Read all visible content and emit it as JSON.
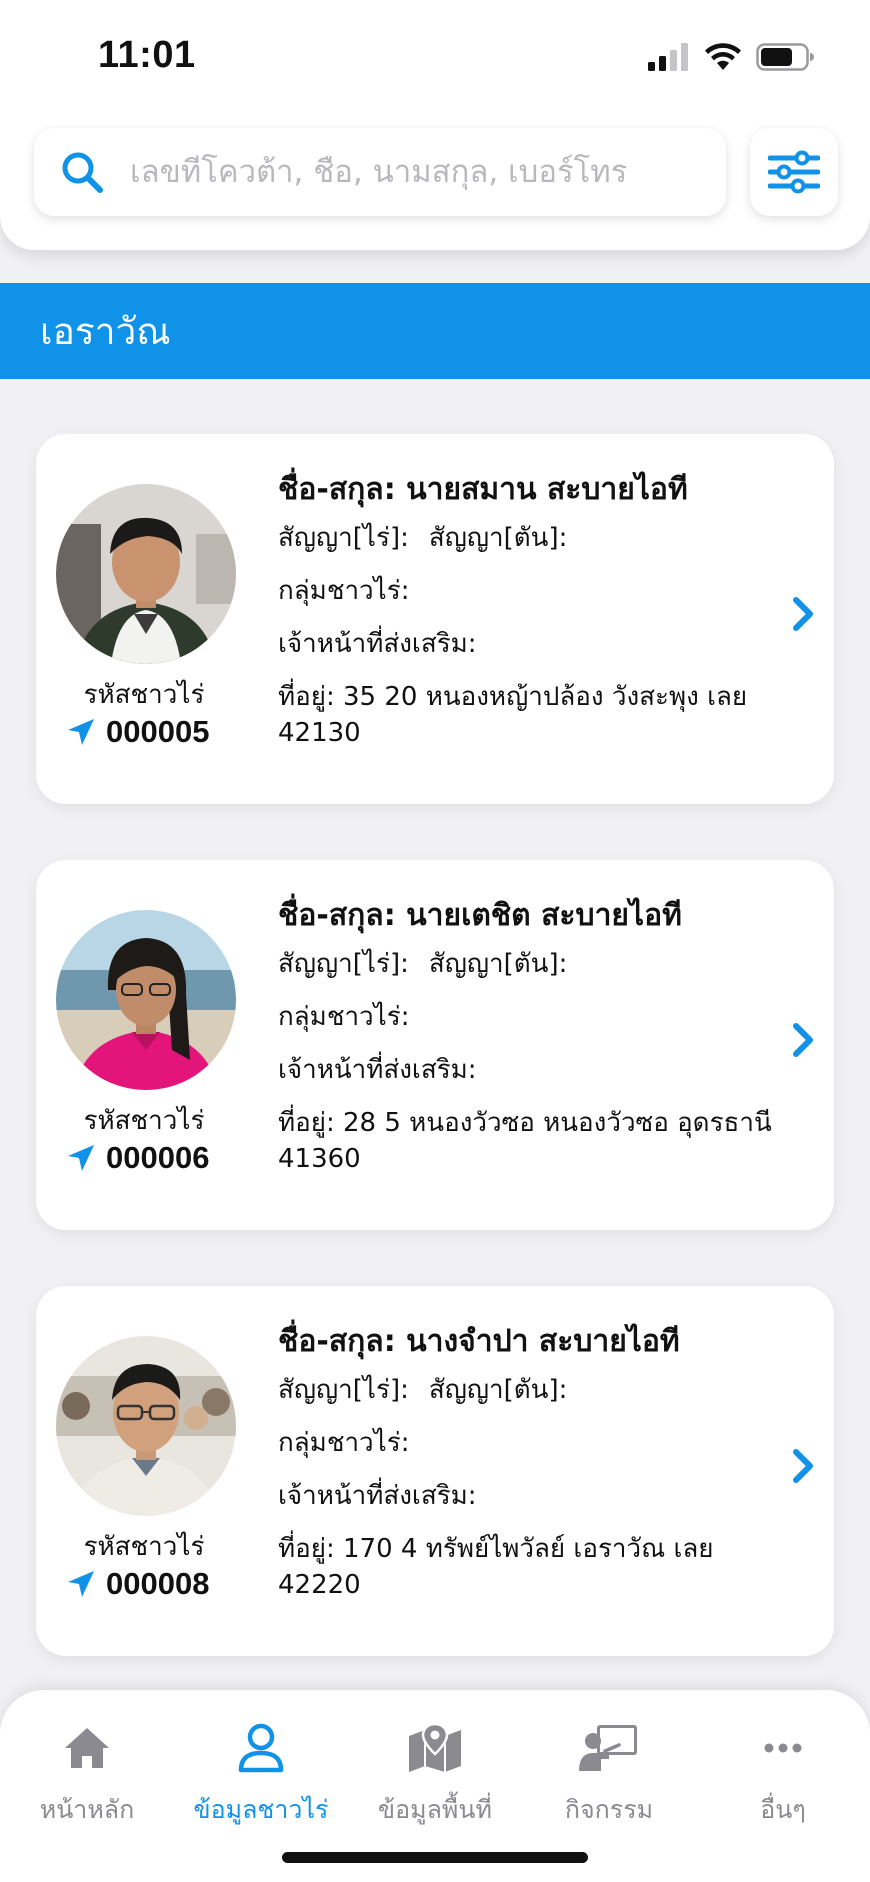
{
  "status_bar": {
    "time": "11:01"
  },
  "search": {
    "placeholder": "เลขที่โควต้า, ชื่อ, นามสกุล, เบอร์โทร",
    "value": ""
  },
  "section": {
    "title": "เอราวัณ"
  },
  "card_labels": {
    "name_prefix": "ชื่อ-สกุล: ",
    "contract_rai": "สัญญา[ไร่]:",
    "contract_ton": "สัญญา[ตัน]:",
    "farmer_group": "กลุ่มชาวไร่:",
    "officer": "เจ้าหน้าที่ส่งเสริม:",
    "address_prefix": "ที่อยู่: ",
    "code_label": "รหัสชาวไร่"
  },
  "farmers": [
    {
      "name": "นายสมาน สะบายไอที",
      "address": "35 20 หนองหญ้าปล้อง วังสะพุง เลย 42130",
      "code": "000005"
    },
    {
      "name": "นายเตชิต สะบายไอที",
      "address": "28 5 หนองวัวซอ หนองวัวซอ อุดรธานี 41360",
      "code": "000006"
    },
    {
      "name": "นางจำปา สะบายไอที",
      "address": "170 4 ทรัพย์ไพวัลย์ เอราวัณ เลย 42220",
      "code": "000008"
    }
  ],
  "tabs": [
    {
      "label": "หน้าหลัก",
      "icon": "home-icon",
      "active": false
    },
    {
      "label": "ข้อมูลชาวไร่",
      "icon": "user-icon",
      "active": true
    },
    {
      "label": "ข้อมูลพื้นที่",
      "icon": "map-icon",
      "active": false
    },
    {
      "label": "กิจกรรม",
      "icon": "presentation-icon",
      "active": false
    },
    {
      "label": "อื่นๆ",
      "icon": "more-icon",
      "active": false
    }
  ],
  "colors": {
    "accent": "#1092e8",
    "tab_inactive": "#8a8a90",
    "background": "#f1f1f3"
  }
}
